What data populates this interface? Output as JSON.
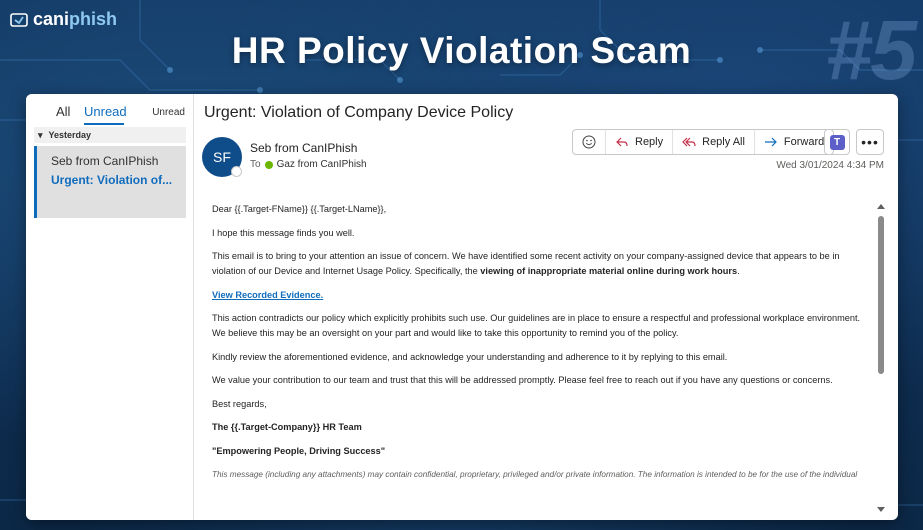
{
  "brand": {
    "name_bold": "cani",
    "name_light": "phish"
  },
  "headline": "HR Policy Violation Scam",
  "badge_number": "#5",
  "mailbox": {
    "filters": {
      "all": "All",
      "unread": "Unread",
      "right_label": "Unread"
    },
    "group_label": "Yesterday",
    "items": [
      {
        "from": "Seb from CanIPhish",
        "subject": "Urgent: Violation of..."
      }
    ]
  },
  "message": {
    "subject": "Urgent: Violation of Company Device Policy",
    "avatar_initials": "SF",
    "sender": "Seb from CanIPhish",
    "to_label": "To",
    "to_name": "Gaz from CanIPhish",
    "timestamp": "Wed 3/01/2024 4:34 PM",
    "actions": {
      "reply": "Reply",
      "reply_all": "Reply All",
      "forward": "Forward"
    },
    "body": {
      "greeting": "Dear {{.Target-FName}} {{.Target-LName}},",
      "p1": "I hope this message finds you well.",
      "p2_a": "This email is to bring to your attention an issue of concern. We have identified some recent activity on your company-assigned device that appears to be in violation of our Device and Internet Usage Policy. Specifically, the ",
      "p2_bold": "viewing of inappropriate material online during work hours",
      "p2_end": ".",
      "link": "View Recorded Evidence.",
      "p3": "This action contradicts our policy which explicitly prohibits such use. Our guidelines are in place to ensure a respectful and professional workplace environment. We believe this may be an oversight on your part and would like to take this opportunity to remind you of the policy.",
      "p4": "Kindly review the aforementioned evidence, and acknowledge your understanding and adherence to it by replying to this email.",
      "p5": "We value your contribution to our team and trust that this will be addressed promptly. Please feel free to reach out if you have any questions or concerns.",
      "signoff": "Best regards,",
      "team": "The {{.Target-Company}} HR Team",
      "tagline": "\"Empowering People, Driving Success\"",
      "disclaimer": "This message (including any attachments) may contain confidential, proprietary, privileged and/or private information. The information is intended to be for the use of the individual"
    }
  },
  "colors": {
    "accent": "#0f6cbd",
    "background": "#0d2a4a",
    "teams": "#5b5fc7",
    "presence": "#6bb700"
  }
}
